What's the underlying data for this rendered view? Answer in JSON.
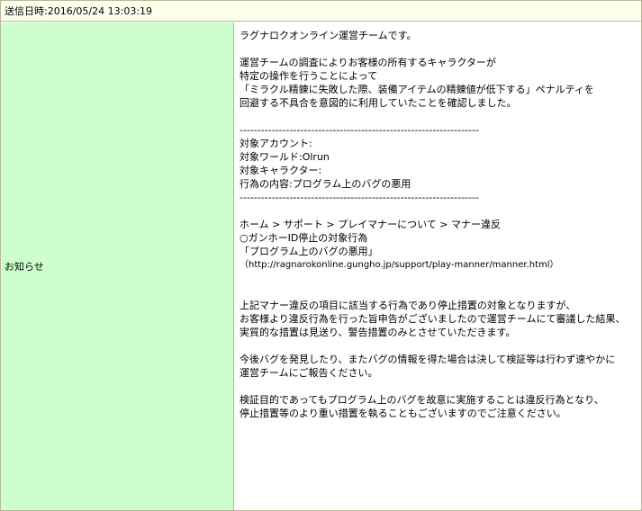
{
  "header": {
    "sent_label": "送信日時:",
    "sent_datetime": "2016/05/24 13:03:19"
  },
  "row": {
    "label": "お知らせ"
  },
  "message": {
    "lines": [
      "ラグナロクオンライン運営チームです。",
      "",
      "運営チームの調査によりお客様の所有するキャラクターが",
      "特定の操作を行うことによって",
      "「ミラクル精錬に失敗した際、装備アイテムの精錬値が低下する」ペナルティを",
      "回避する不具合を意図的に利用していたことを確認しました。",
      "",
      "-------------------------------------------------------------------",
      "対象アカウント:",
      "対象ワールド:Olrun",
      "対象キャラクター:",
      "行為の内容:プログラム上のバグの悪用",
      "-------------------------------------------------------------------",
      "",
      "ホーム > サポート > プレイマナーについて > マナー違反",
      "○ガンホーID停止の対象行為",
      "「プログラム上のバグの悪用」",
      "（http://ragnarokonline.gungho.jp/support/play-manner/manner.html）",
      "",
      "",
      "上記マナー違反の項目に該当する行為であり停止措置の対象となりますが、",
      "お客様より違反行為を行った旨申告がございましたので運営チームにて審議した結果、",
      "実質的な措置は見送り、警告措置のみとさせていただきます。",
      "",
      "今後バグを発見したり、またバグの情報を得た場合は決して検証等は行わず速やかに",
      "運営チームにご報告ください。",
      "",
      "検証目的であってもプログラム上のバグを故意に実施することは違反行為となり、",
      "停止措置等のより重い措置を執ることもございますのでご注意ください。"
    ]
  }
}
